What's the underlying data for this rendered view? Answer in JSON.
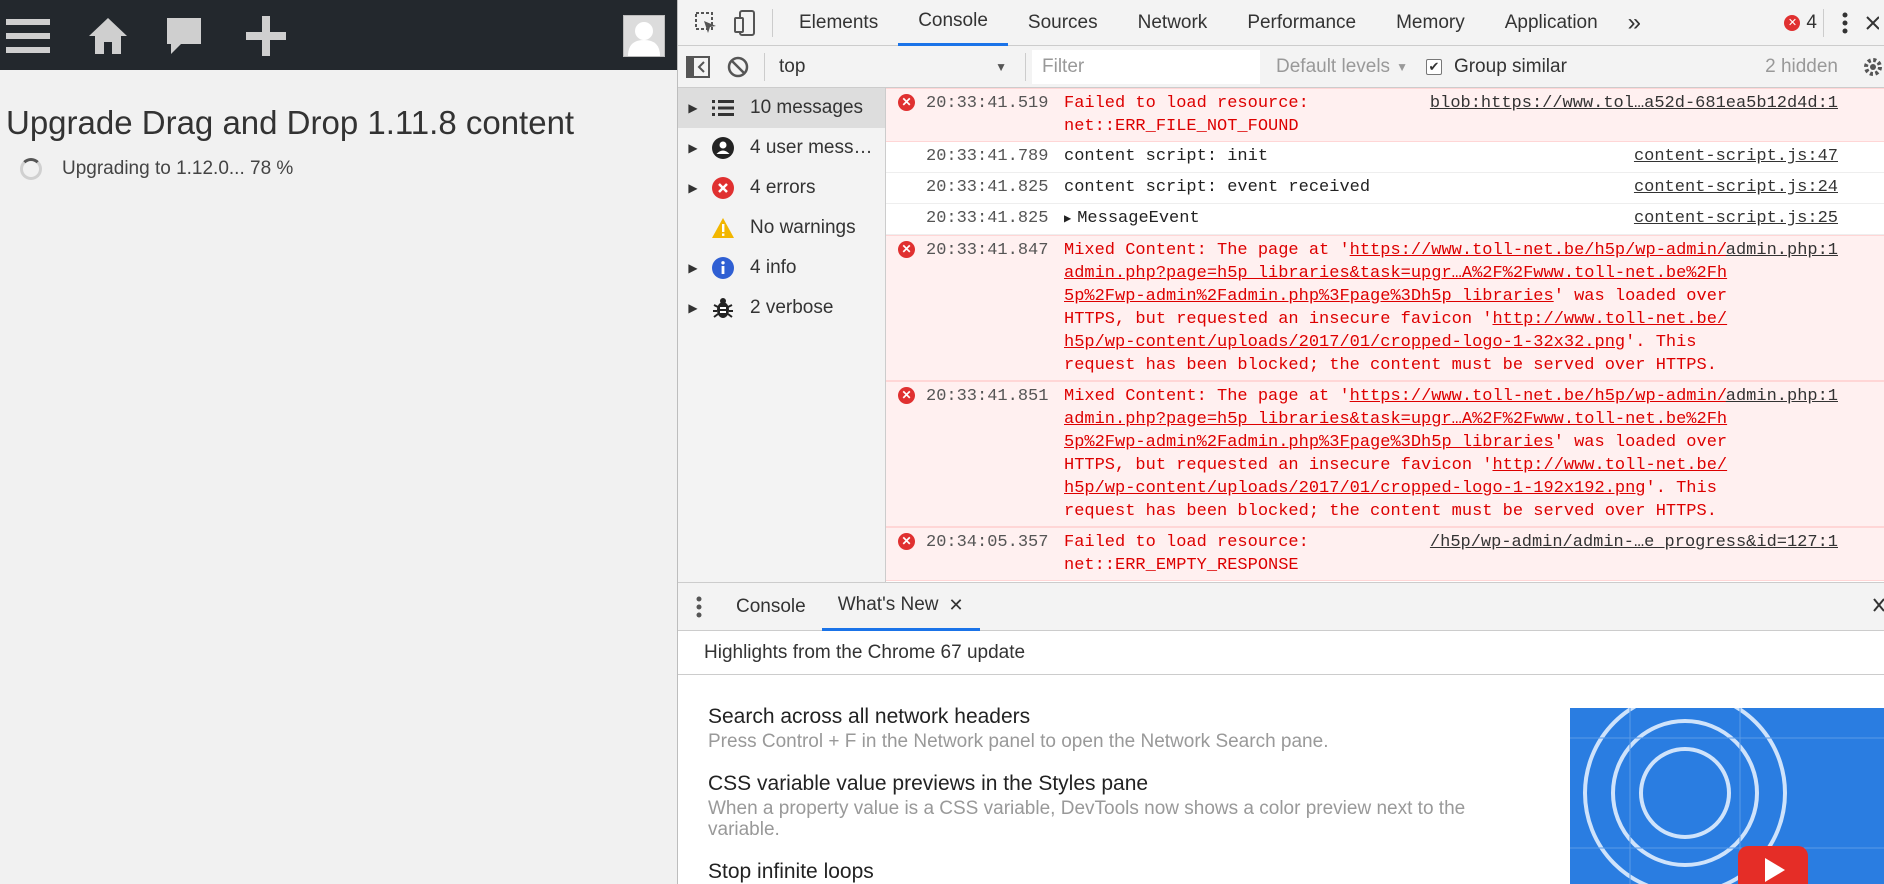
{
  "app": {
    "page_title": "Upgrade Drag and Drop 1.11.8 content",
    "progress_text": "Upgrading to 1.12.0... 78 %"
  },
  "devtools": {
    "tabs": [
      "Elements",
      "Console",
      "Sources",
      "Network",
      "Performance",
      "Memory",
      "Application"
    ],
    "active_tab": "Console",
    "error_count": "4",
    "more_tabs_glyph": "»",
    "console_toolbar": {
      "context": "top",
      "filter_placeholder": "Filter",
      "levels": "Default levels",
      "group_similar_label": "Group similar",
      "hidden": "2 hidden"
    },
    "sidebar": [
      {
        "label": "10 messages",
        "icon": "list-icon"
      },
      {
        "label": "4 user mess…",
        "icon": "user-icon"
      },
      {
        "label": "4 errors",
        "icon": "error-icon"
      },
      {
        "label": "No warnings",
        "icon": "warning-icon"
      },
      {
        "label": "4 info",
        "icon": "info-icon"
      },
      {
        "label": "2 verbose",
        "icon": "bug-icon"
      }
    ],
    "messages": [
      {
        "type": "error",
        "ts": "20:33:41.519",
        "text": "Failed to load resource: net::ERR_FILE_NOT_FOUND",
        "src": "blob:https://www.tol…a52d-681ea5b12d4d:1"
      },
      {
        "type": "log",
        "ts": "20:33:41.789",
        "text": "content script: init",
        "src": "content-script.js:47"
      },
      {
        "type": "log",
        "ts": "20:33:41.825",
        "text": "content script: event received",
        "src": "content-script.js:24"
      },
      {
        "type": "log",
        "ts": "20:33:41.825",
        "text": "MessageEvent",
        "src": "content-script.js:25"
      },
      {
        "type": "error",
        "ts": "20:33:41.847",
        "pre": "Mixed Content: The page at '",
        "link1": "https://www.toll-net.be/h5p/wp-admin/admin.php?page=h5p_libraries&task=upgr…A%2F%2Fwww.toll-net.be%2Fh5p%2Fwp-admin%2Fadmin.php%3Fpage%3Dh5p_libraries",
        "mid": "' was loaded over HTTPS, but requested an insecure favicon '",
        "link2": "http://www.toll-net.be/h5p/wp-content/uploads/2017/01/cropped-logo-1-32x32.png",
        "post": "'. This request has been blocked; the content must be served over HTTPS.",
        "src": "admin.php:1"
      },
      {
        "type": "error",
        "ts": "20:33:41.851",
        "pre": "Mixed Content: The page at '",
        "link1": "https://www.toll-net.be/h5p/wp-admin/admin.php?page=h5p_libraries&task=upgr…A%2F%2Fwww.toll-net.be%2Fh5p%2Fwp-admin%2Fadmin.php%3Fpage%3Dh5p_libraries",
        "mid": "' was loaded over HTTPS, but requested an insecure favicon '",
        "link2": "http://www.toll-net.be/h5p/wp-content/uploads/2017/01/cropped-logo-1-192x192.png",
        "post": "'. This request has been blocked; the content must be served over HTTPS.",
        "src": "admin.php:1"
      },
      {
        "type": "error",
        "ts": "20:34:05.357",
        "text": "Failed to load resource: net::ERR_EMPTY_RESPONSE",
        "src": "/h5p/wp-admin/admin-…e_progress&id=127:1"
      }
    ],
    "drawer": {
      "tabs": [
        "Console",
        "What's New"
      ],
      "active_tab": "What's New",
      "close_glyph": "✕",
      "highlights": "Highlights from the Chrome 67 update",
      "news": [
        {
          "title": "Search across all network headers",
          "desc": "Press Control + F in the Network panel to open the Network Search pane."
        },
        {
          "title": "CSS variable value previews in the Styles pane",
          "desc": "When a property value is a CSS variable, DevTools now shows a color preview next to the variable."
        },
        {
          "title": "Stop infinite loops",
          "desc": ""
        }
      ]
    }
  },
  "colors": {
    "toolbar_bg": "#23282d",
    "accent": "#1a73e8",
    "error": "#d00000",
    "thumb_bg": "#2a7de1"
  }
}
